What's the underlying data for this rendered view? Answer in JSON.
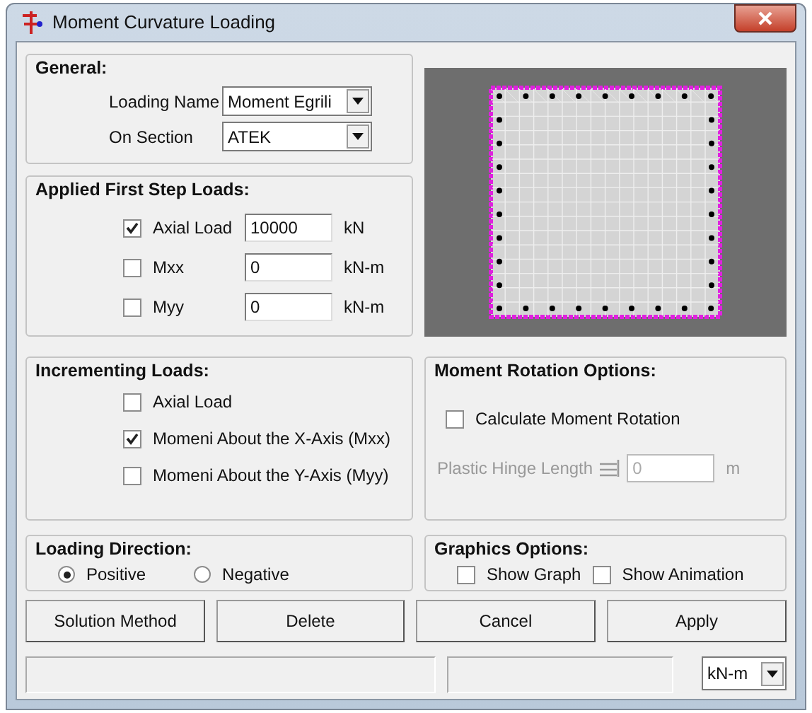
{
  "window": {
    "title": "Moment Curvature Loading"
  },
  "general": {
    "title": "General:",
    "fields": [
      {
        "label": "Loading Name",
        "value": "Moment Egrili"
      },
      {
        "label": "On Section",
        "value": "ATEK"
      }
    ]
  },
  "applied_loads": {
    "title": "Applied First Step Loads:",
    "rows": [
      {
        "label": "Axial Load",
        "checked": true,
        "value": "10000",
        "unit": "kN"
      },
      {
        "label": "Mxx",
        "checked": false,
        "value": "0",
        "unit": "kN-m"
      },
      {
        "label": "Myy",
        "checked": false,
        "value": "0",
        "unit": "kN-m"
      }
    ]
  },
  "incrementing_loads": {
    "title": "Incrementing Loads:",
    "items": [
      {
        "label": "Axial Load",
        "checked": false
      },
      {
        "label": "Momeni About the X-Axis (Mxx)",
        "checked": true
      },
      {
        "label": "Momeni About the Y-Axis (Myy)",
        "checked": false
      }
    ]
  },
  "moment_rotation": {
    "title": "Moment Rotation Options:",
    "checkbox": {
      "label": "Calculate Moment Rotation",
      "checked": false
    },
    "hinge": {
      "label": "Plastic Hinge Length",
      "value": "0",
      "unit": "m",
      "disabled": true
    }
  },
  "loading_direction": {
    "title": "Loading Direction:",
    "options": [
      {
        "label": "Positive",
        "selected": true
      },
      {
        "label": "Negative",
        "selected": false
      }
    ]
  },
  "graphics_options": {
    "title": "Graphics Options:",
    "items": [
      {
        "label": "Show Graph",
        "checked": false
      },
      {
        "label": "Show Animation",
        "checked": false
      }
    ]
  },
  "buttons": [
    "Solution Method",
    "Delete",
    "Cancel",
    "Apply"
  ],
  "status_bar": {
    "unit": "kN-m"
  }
}
